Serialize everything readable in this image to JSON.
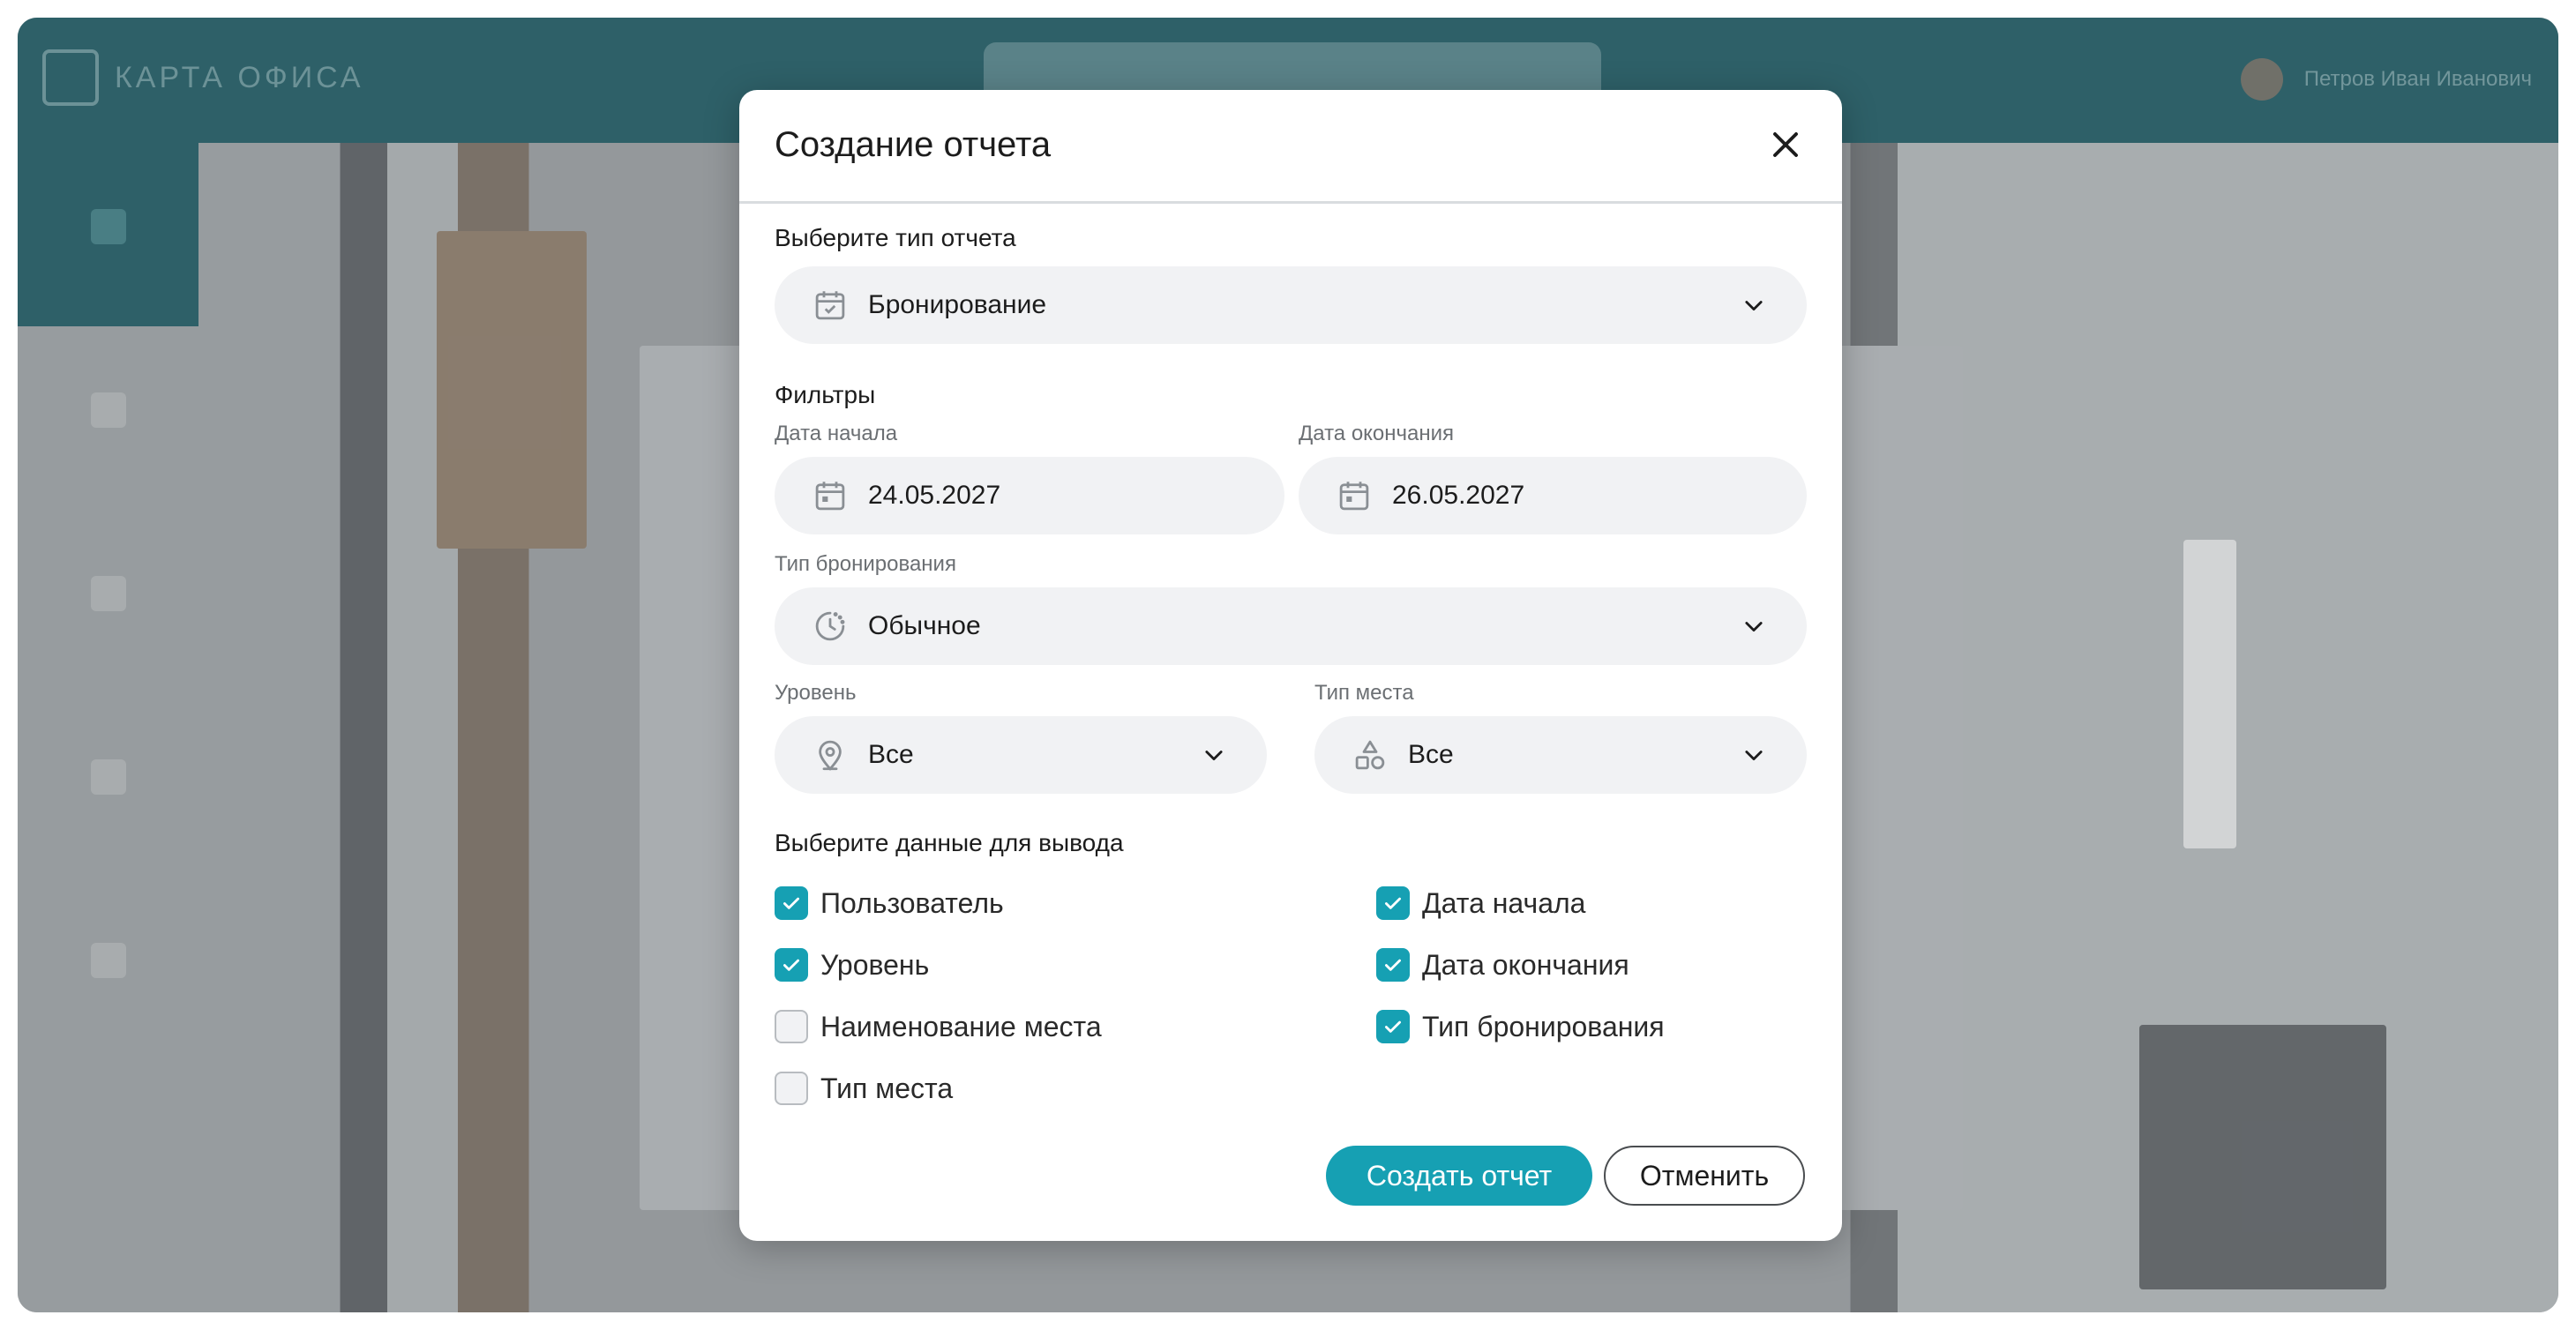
{
  "background_app": {
    "brand_name": "КАРТА ОФИСА",
    "user_name": "Петров Иван Иванович"
  },
  "modal": {
    "title": "Создание отчета",
    "report_type": {
      "label": "Выберите тип отчета",
      "value": "Бронирование"
    },
    "filters": {
      "heading": "Фильтры",
      "start_date": {
        "label": "Дата начала",
        "value": "24.05.2027"
      },
      "end_date": {
        "label": "Дата окончания",
        "value": "26.05.2027"
      },
      "booking_type": {
        "label": "Тип бронирования",
        "value": "Обычное"
      },
      "level": {
        "label": "Уровень",
        "value": "Все"
      },
      "place_type": {
        "label": "Тип места",
        "value": "Все"
      }
    },
    "output": {
      "heading": "Выберите данные для вывода",
      "left": [
        {
          "label": "Пользователь",
          "checked": true
        },
        {
          "label": "Уровень",
          "checked": true
        },
        {
          "label": "Наименование места",
          "checked": false
        },
        {
          "label": "Тип места",
          "checked": false
        }
      ],
      "right": [
        {
          "label": "Дата начала",
          "checked": true
        },
        {
          "label": "Дата окончания",
          "checked": true
        },
        {
          "label": "Тип бронирования",
          "checked": true
        }
      ]
    },
    "actions": {
      "create": "Создать отчет",
      "cancel": "Отменить"
    }
  },
  "colors": {
    "accent": "#16a0b3",
    "header": "#1e5a63"
  }
}
